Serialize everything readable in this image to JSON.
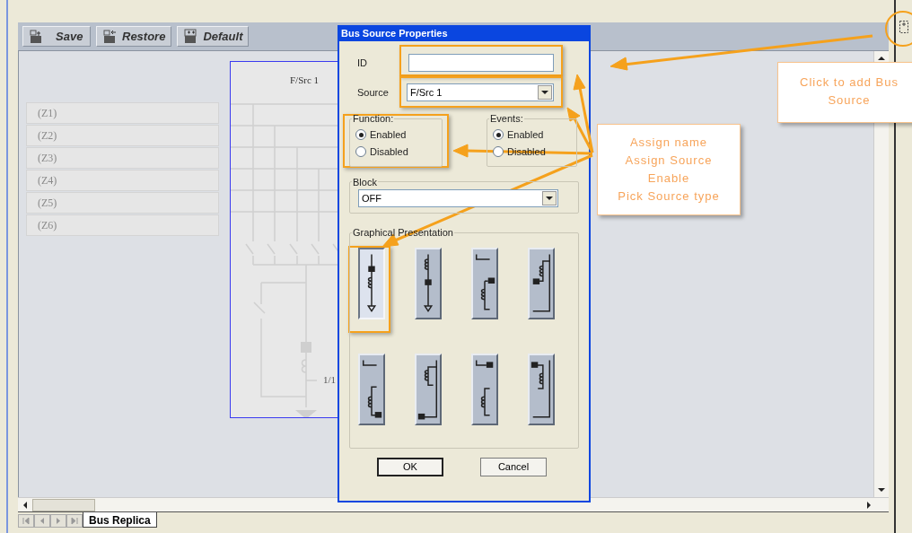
{
  "toolbar": {
    "buttons": [
      {
        "label": "Save"
      },
      {
        "label": "Restore"
      },
      {
        "label": "Default"
      }
    ]
  },
  "zones": [
    "(Z1)",
    "(Z2)",
    "(Z3)",
    "(Z4)",
    "(Z5)",
    "(Z6)"
  ],
  "diagram": {
    "title": "F/Src 1",
    "ratio": "1/1"
  },
  "dialog": {
    "title": "Bus Source Properties",
    "id_field": {
      "label": "ID"
    },
    "source": {
      "label": "Source",
      "value": "F/Src 1"
    },
    "function": {
      "title": "Function:",
      "options": [
        {
          "label": "Enabled",
          "selected": true
        },
        {
          "label": "Disabled",
          "selected": false
        }
      ]
    },
    "events": {
      "title": "Events:",
      "options": [
        {
          "label": "Enabled",
          "selected": true
        },
        {
          "label": "Disabled",
          "selected": false
        }
      ]
    },
    "block": {
      "title": "Block",
      "value": "OFF"
    },
    "graphical_presentation": {
      "title": "Graphical Presentation",
      "tiles": [
        {
          "selected": true
        },
        {
          "selected": false
        },
        {
          "selected": false
        },
        {
          "selected": false
        },
        {
          "selected": false
        },
        {
          "selected": false
        },
        {
          "selected": false
        },
        {
          "selected": false
        }
      ]
    },
    "buttons": [
      {
        "label": "OK",
        "default": true
      },
      {
        "label": "Cancel",
        "default": false
      }
    ]
  },
  "sheet_tabs": [
    {
      "label": "Bus Replica",
      "selected": true
    }
  ],
  "callouts": [
    {
      "lines": [
        "Click to add Bus Source"
      ]
    },
    {
      "lines": [
        "Assign name",
        "Assign Source",
        "Enable",
        "Pick Source type"
      ]
    }
  ]
}
